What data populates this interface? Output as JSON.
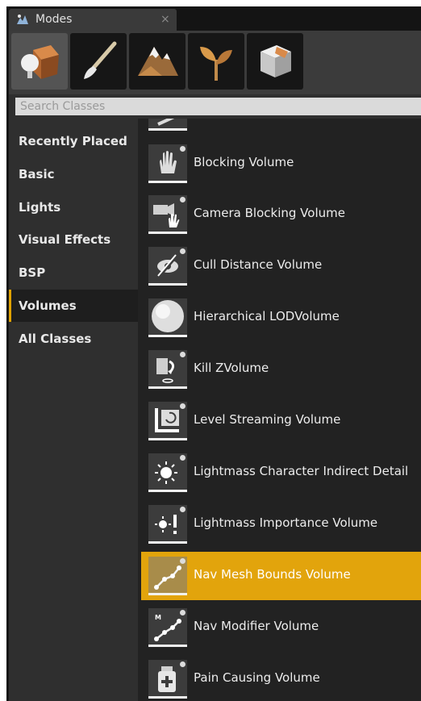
{
  "window": {
    "title": "Modes",
    "close_glyph": "×",
    "title_icon": "modes-icon"
  },
  "mode_tabs": [
    {
      "name": "place-mode",
      "icon": "place-cube-icon",
      "active": true
    },
    {
      "name": "paint-mode",
      "icon": "paintbrush-icon",
      "active": false
    },
    {
      "name": "landscape-mode",
      "icon": "mountain-icon",
      "active": false
    },
    {
      "name": "foliage-mode",
      "icon": "leaf-icon",
      "active": false
    },
    {
      "name": "geometry-mode",
      "icon": "geometry-cube-icon",
      "active": false
    }
  ],
  "search": {
    "placeholder": "Search Classes",
    "value": ""
  },
  "categories": [
    {
      "label": "Recently Placed",
      "active": false
    },
    {
      "label": "Basic",
      "active": false
    },
    {
      "label": "Lights",
      "active": false
    },
    {
      "label": "Visual Effects",
      "active": false
    },
    {
      "label": "BSP",
      "active": false
    },
    {
      "label": "Volumes",
      "active": true
    },
    {
      "label": "All Classes",
      "active": false
    }
  ],
  "items": [
    {
      "label": "Blocking Volume",
      "icon": "hand-icon",
      "selected": false
    },
    {
      "label": "Camera Blocking Volume",
      "icon": "camera-block-icon",
      "selected": false
    },
    {
      "label": "Cull Distance Volume",
      "icon": "eye-slash-icon",
      "selected": false
    },
    {
      "label": "Hierarchical LODVolume",
      "icon": "sphere-icon",
      "selected": false
    },
    {
      "label": "Kill ZVolume",
      "icon": "kill-z-icon",
      "selected": false
    },
    {
      "label": "Level Streaming Volume",
      "icon": "level-streaming-icon",
      "selected": false
    },
    {
      "label": "Lightmass Character Indirect Detail",
      "icon": "sun-icon",
      "selected": false
    },
    {
      "label": "Lightmass Importance Volume",
      "icon": "sun-exclaim-icon",
      "selected": false
    },
    {
      "label": "Nav Mesh Bounds Volume",
      "icon": "nav-mesh-icon",
      "selected": true
    },
    {
      "label": "Nav Modifier Volume",
      "icon": "nav-modifier-icon",
      "selected": false
    },
    {
      "label": "Pain Causing Volume",
      "icon": "medkit-icon",
      "selected": false
    }
  ],
  "colors": {
    "accent": "#e2a40c",
    "panel": "#2f2f2f",
    "list_bg": "#222222"
  }
}
